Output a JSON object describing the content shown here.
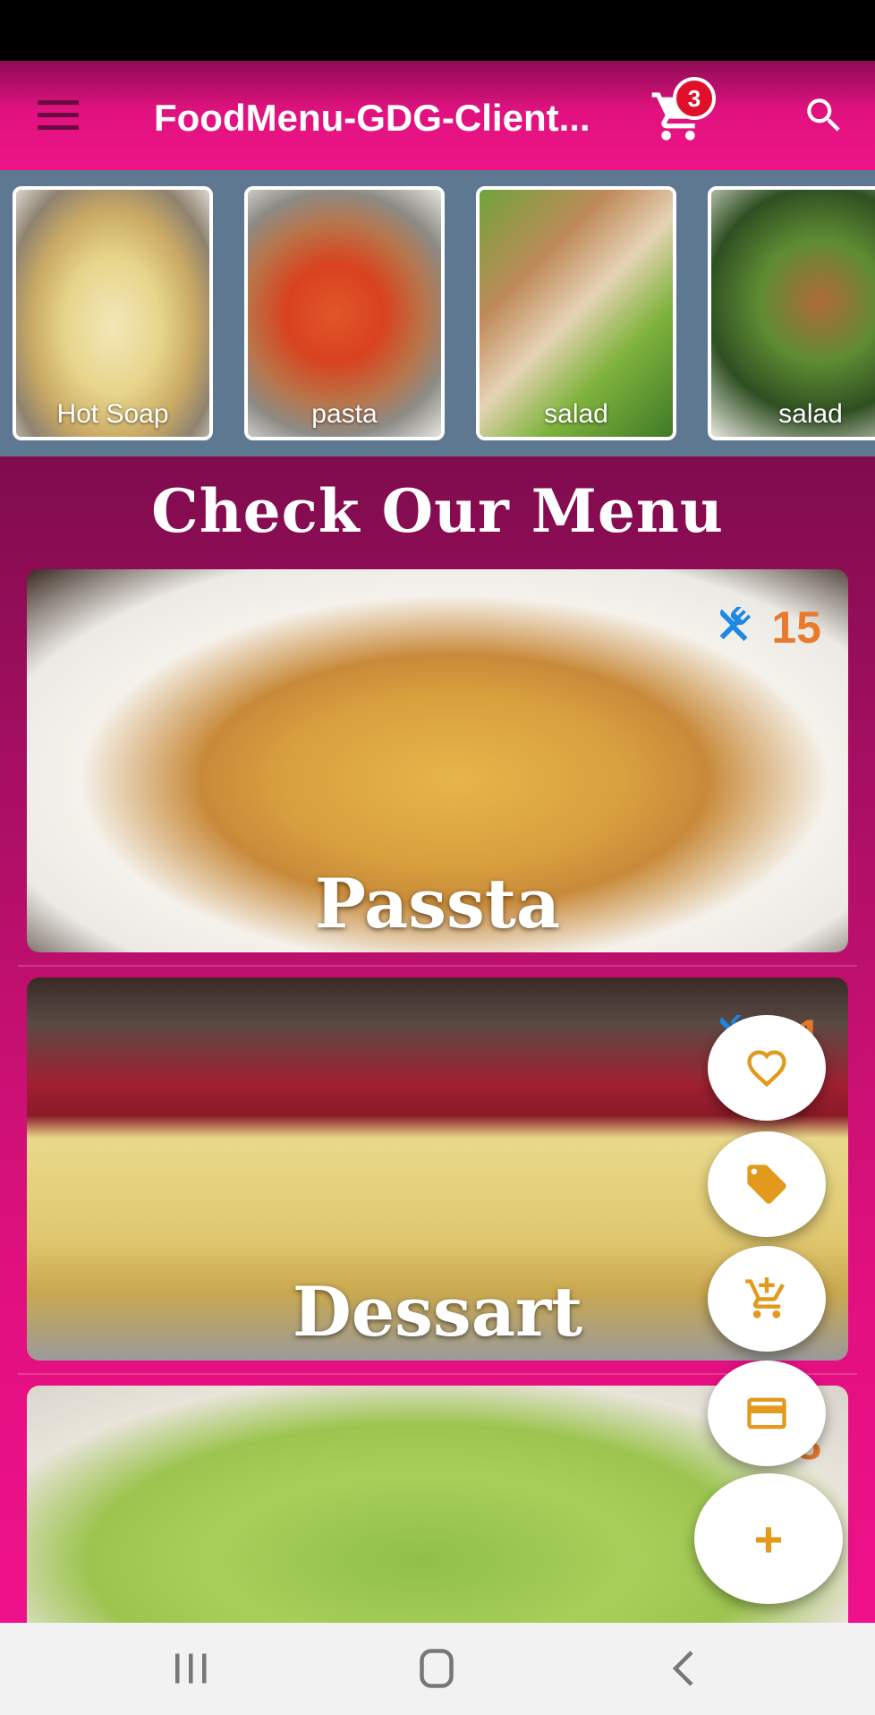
{
  "app": {
    "title": "FoodMenu-GDG-Client..."
  },
  "header": {
    "cart_count": "3"
  },
  "colors": {
    "accent": "#ee1486",
    "fab_icon": "#e39a1c",
    "count": "#e97a2c",
    "strip_bg": "#5e7892"
  },
  "categories": [
    {
      "label": "Hot Soap"
    },
    {
      "label": "pasta"
    },
    {
      "label": "salad"
    },
    {
      "label": "salad"
    }
  ],
  "menu": {
    "title": "Check Our Menu",
    "items": [
      {
        "name": "Passta",
        "count": "15"
      },
      {
        "name": "Dessart",
        "count": "21"
      },
      {
        "name": "",
        "count": "8"
      }
    ]
  },
  "fab": {
    "plus_label": "+"
  },
  "icons": [
    "menu-icon",
    "cart-icon",
    "search-icon",
    "utensils-icon",
    "heart-icon",
    "tag-icon",
    "add-cart-icon",
    "credit-card-icon",
    "recents-icon",
    "home-icon",
    "back-icon"
  ]
}
